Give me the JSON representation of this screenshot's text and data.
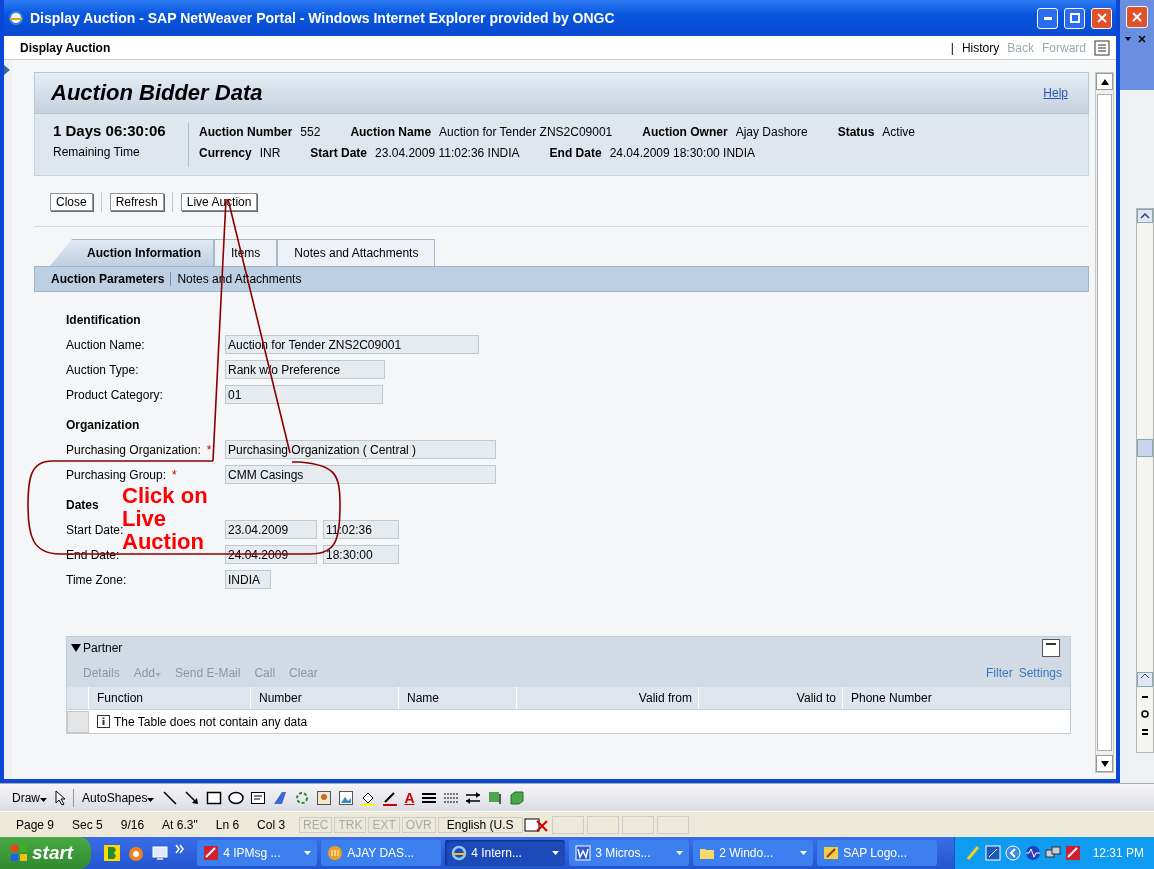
{
  "window": {
    "title": "Display Auction - SAP NetWeaver Portal - Windows Internet Explorer provided by ONGC"
  },
  "portal_bar": {
    "title": "Display Auction",
    "separator": "|",
    "links": [
      {
        "label": "History",
        "disabled": false
      },
      {
        "label": "Back",
        "disabled": true
      },
      {
        "label": "Forward",
        "disabled": true
      }
    ]
  },
  "page": {
    "title": "Auction Bidder Data",
    "help": "Help"
  },
  "summary": {
    "remaining": "1 Days 06:30:06",
    "remaining_label": "Remaining Time",
    "rows": [
      [
        {
          "label": "Auction Number",
          "value": "552"
        },
        {
          "label": "Auction Name",
          "value": "Auction for Tender ZNS2C09001"
        },
        {
          "label": "Auction Owner",
          "value": "Ajay Dashore"
        },
        {
          "label": "Status",
          "value": "Active"
        }
      ],
      [
        {
          "label": "Currency",
          "value": "INR"
        },
        {
          "label": "Start Date",
          "value": "23.04.2009 11:02:36 INDIA"
        },
        {
          "label": "End Date",
          "value": "24.04.2009 18:30:00 INDIA"
        }
      ]
    ]
  },
  "toolbar": [
    "Close",
    "Refresh",
    "Live Auction"
  ],
  "tabs": [
    {
      "label": "Auction Information",
      "selected": true
    },
    {
      "label": "Items",
      "selected": false
    },
    {
      "label": "Notes and Attachments",
      "selected": false
    }
  ],
  "subtabs": [
    {
      "label": "Auction Parameters",
      "selected": true
    },
    {
      "label": "Notes and Attachments",
      "selected": false
    }
  ],
  "form": {
    "required_mark": "*",
    "sections": [
      {
        "title": "Identification",
        "fields": [
          {
            "label": "Auction Name:",
            "required": false,
            "values": [
              "Auction for Tender ZNS2C09001"
            ]
          },
          {
            "label": "Auction Type:",
            "required": false,
            "values": [
              "Rank w/o Preference"
            ]
          },
          {
            "label": "Product Category:",
            "required": false,
            "values": [
              "01"
            ]
          }
        ]
      },
      {
        "title": "Organization",
        "fields": [
          {
            "label": "Purchasing Organization:",
            "required": true,
            "values": [
              "Purchasing Organization ( Central )"
            ]
          },
          {
            "label": "Purchasing Group:",
            "required": true,
            "values": [
              "CMM Casings"
            ]
          }
        ]
      },
      {
        "title": "Dates",
        "fields": [
          {
            "label": "Start Date:",
            "required": false,
            "values": [
              "23.04.2009",
              "11:02:36"
            ]
          },
          {
            "label": "End Date:",
            "required": false,
            "values": [
              "24.04.2009",
              "18:30:00"
            ]
          },
          {
            "label": "Time Zone:",
            "required": false,
            "values": [
              "INDIA"
            ]
          }
        ]
      }
    ]
  },
  "partner": {
    "title": "Partner",
    "expanded": true,
    "actions": [
      {
        "label": "Details",
        "menu": false
      },
      {
        "label": "Add",
        "menu": true
      },
      {
        "label": "Send E-Mail",
        "menu": false
      },
      {
        "label": "Call",
        "menu": false
      },
      {
        "label": "Clear",
        "menu": false
      }
    ],
    "links": [
      "Filter",
      "Settings"
    ],
    "columns": [
      {
        "label": "Function",
        "kind": "text"
      },
      {
        "label": "Number",
        "kind": "text"
      },
      {
        "label": "Name",
        "kind": "text"
      },
      {
        "label": "Valid from",
        "kind": "date"
      },
      {
        "label": "Valid to",
        "kind": "date"
      },
      {
        "label": "Phone Number",
        "kind": "text"
      }
    ],
    "empty_message": "The Table does not contain any data"
  },
  "annotation": {
    "text": "Click on Live Auction"
  },
  "draw_toolbar": {
    "draw": "Draw",
    "autoshapes": "AutoShapes",
    "font_color": "A"
  },
  "word_status": {
    "items": [
      "Page 9",
      "Sec 5",
      "9/16",
      "At 6.3\"",
      "Ln 6",
      "Col 3"
    ],
    "modes": [
      {
        "label": "REC",
        "on": false
      },
      {
        "label": "TRK",
        "on": false
      },
      {
        "label": "EXT",
        "on": false
      },
      {
        "label": "OVR",
        "on": false
      }
    ],
    "language": "English (U.S"
  },
  "taskbar": {
    "start": "start",
    "tasks": [
      {
        "label": "4 IPMsg ...",
        "grouped": true,
        "selected": false
      },
      {
        "label": "AJAY DAS...",
        "grouped": false,
        "selected": false
      },
      {
        "label": "4 Intern...",
        "grouped": true,
        "selected": true
      },
      {
        "label": "3 Micros...",
        "grouped": true,
        "selected": false
      },
      {
        "label": "2 Windo...",
        "grouped": true,
        "selected": false
      },
      {
        "label": "SAP Logo...",
        "grouped": false,
        "selected": false
      }
    ],
    "clock": "12:31 PM"
  }
}
